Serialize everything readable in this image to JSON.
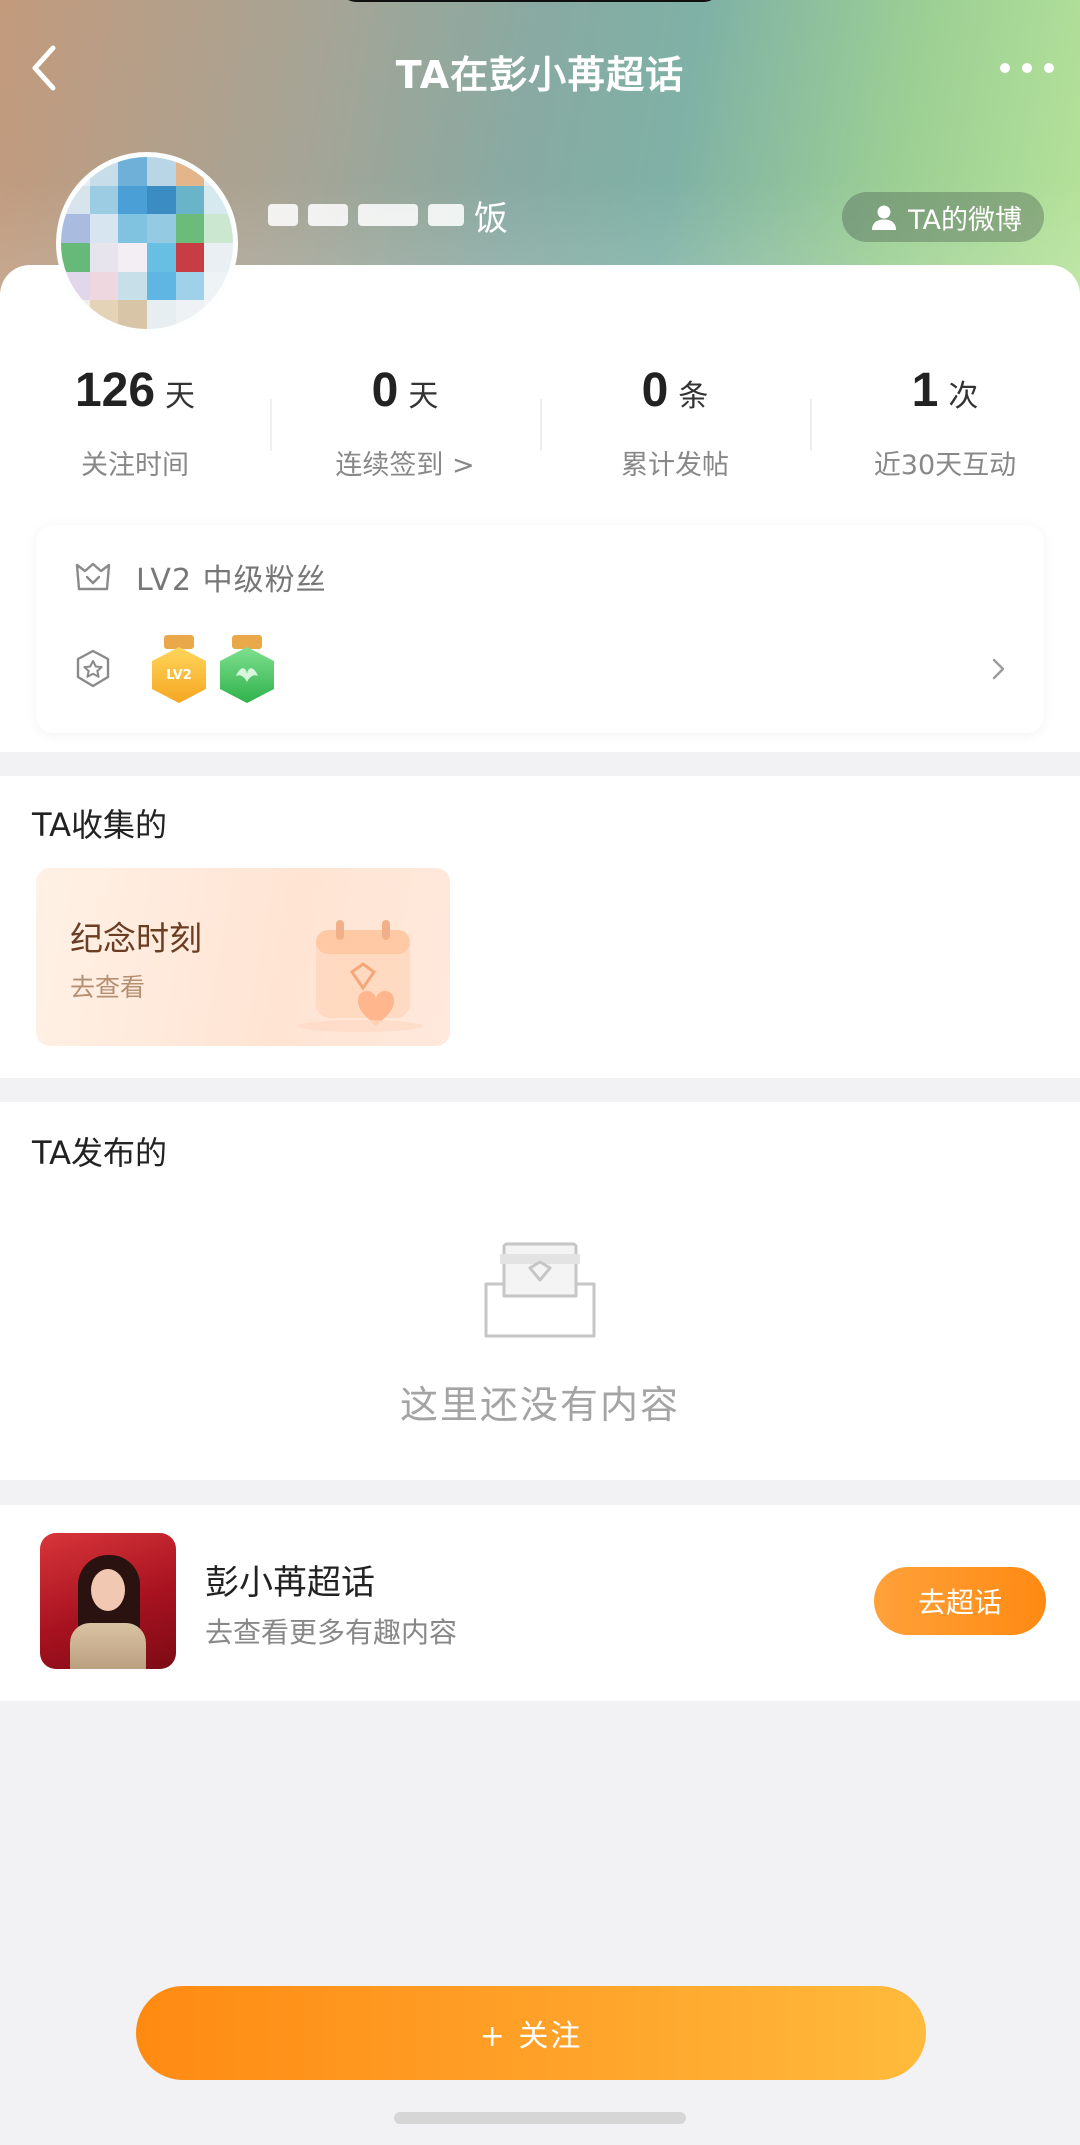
{
  "nav": {
    "title": "TA在彭小苒超话"
  },
  "profile": {
    "name_visible_suffix": "饭",
    "weibo_button_label": "TA的微博"
  },
  "stats": [
    {
      "value": "126",
      "unit": "天",
      "label": "关注时间"
    },
    {
      "value": "0",
      "unit": "天",
      "label": "连续签到 >"
    },
    {
      "value": "0",
      "unit": "条",
      "label": "累计发帖"
    },
    {
      "value": "1",
      "unit": "次",
      "label": "近30天互动"
    }
  ],
  "level": {
    "text": "LV2 中级粉丝",
    "badges": [
      "LV2",
      "bird"
    ]
  },
  "collected": {
    "heading": "TA收集的",
    "card_title": "纪念时刻",
    "card_link": "去查看"
  },
  "posted": {
    "heading": "TA发布的",
    "empty_text": "这里还没有内容"
  },
  "topic": {
    "name": "彭小苒超话",
    "subtitle": "去查看更多有趣内容",
    "button_label": "去超话"
  },
  "follow_button_label": "+ 关注",
  "colors": {
    "accent": "#ff8a12",
    "accent_light": "#ffb43a"
  }
}
